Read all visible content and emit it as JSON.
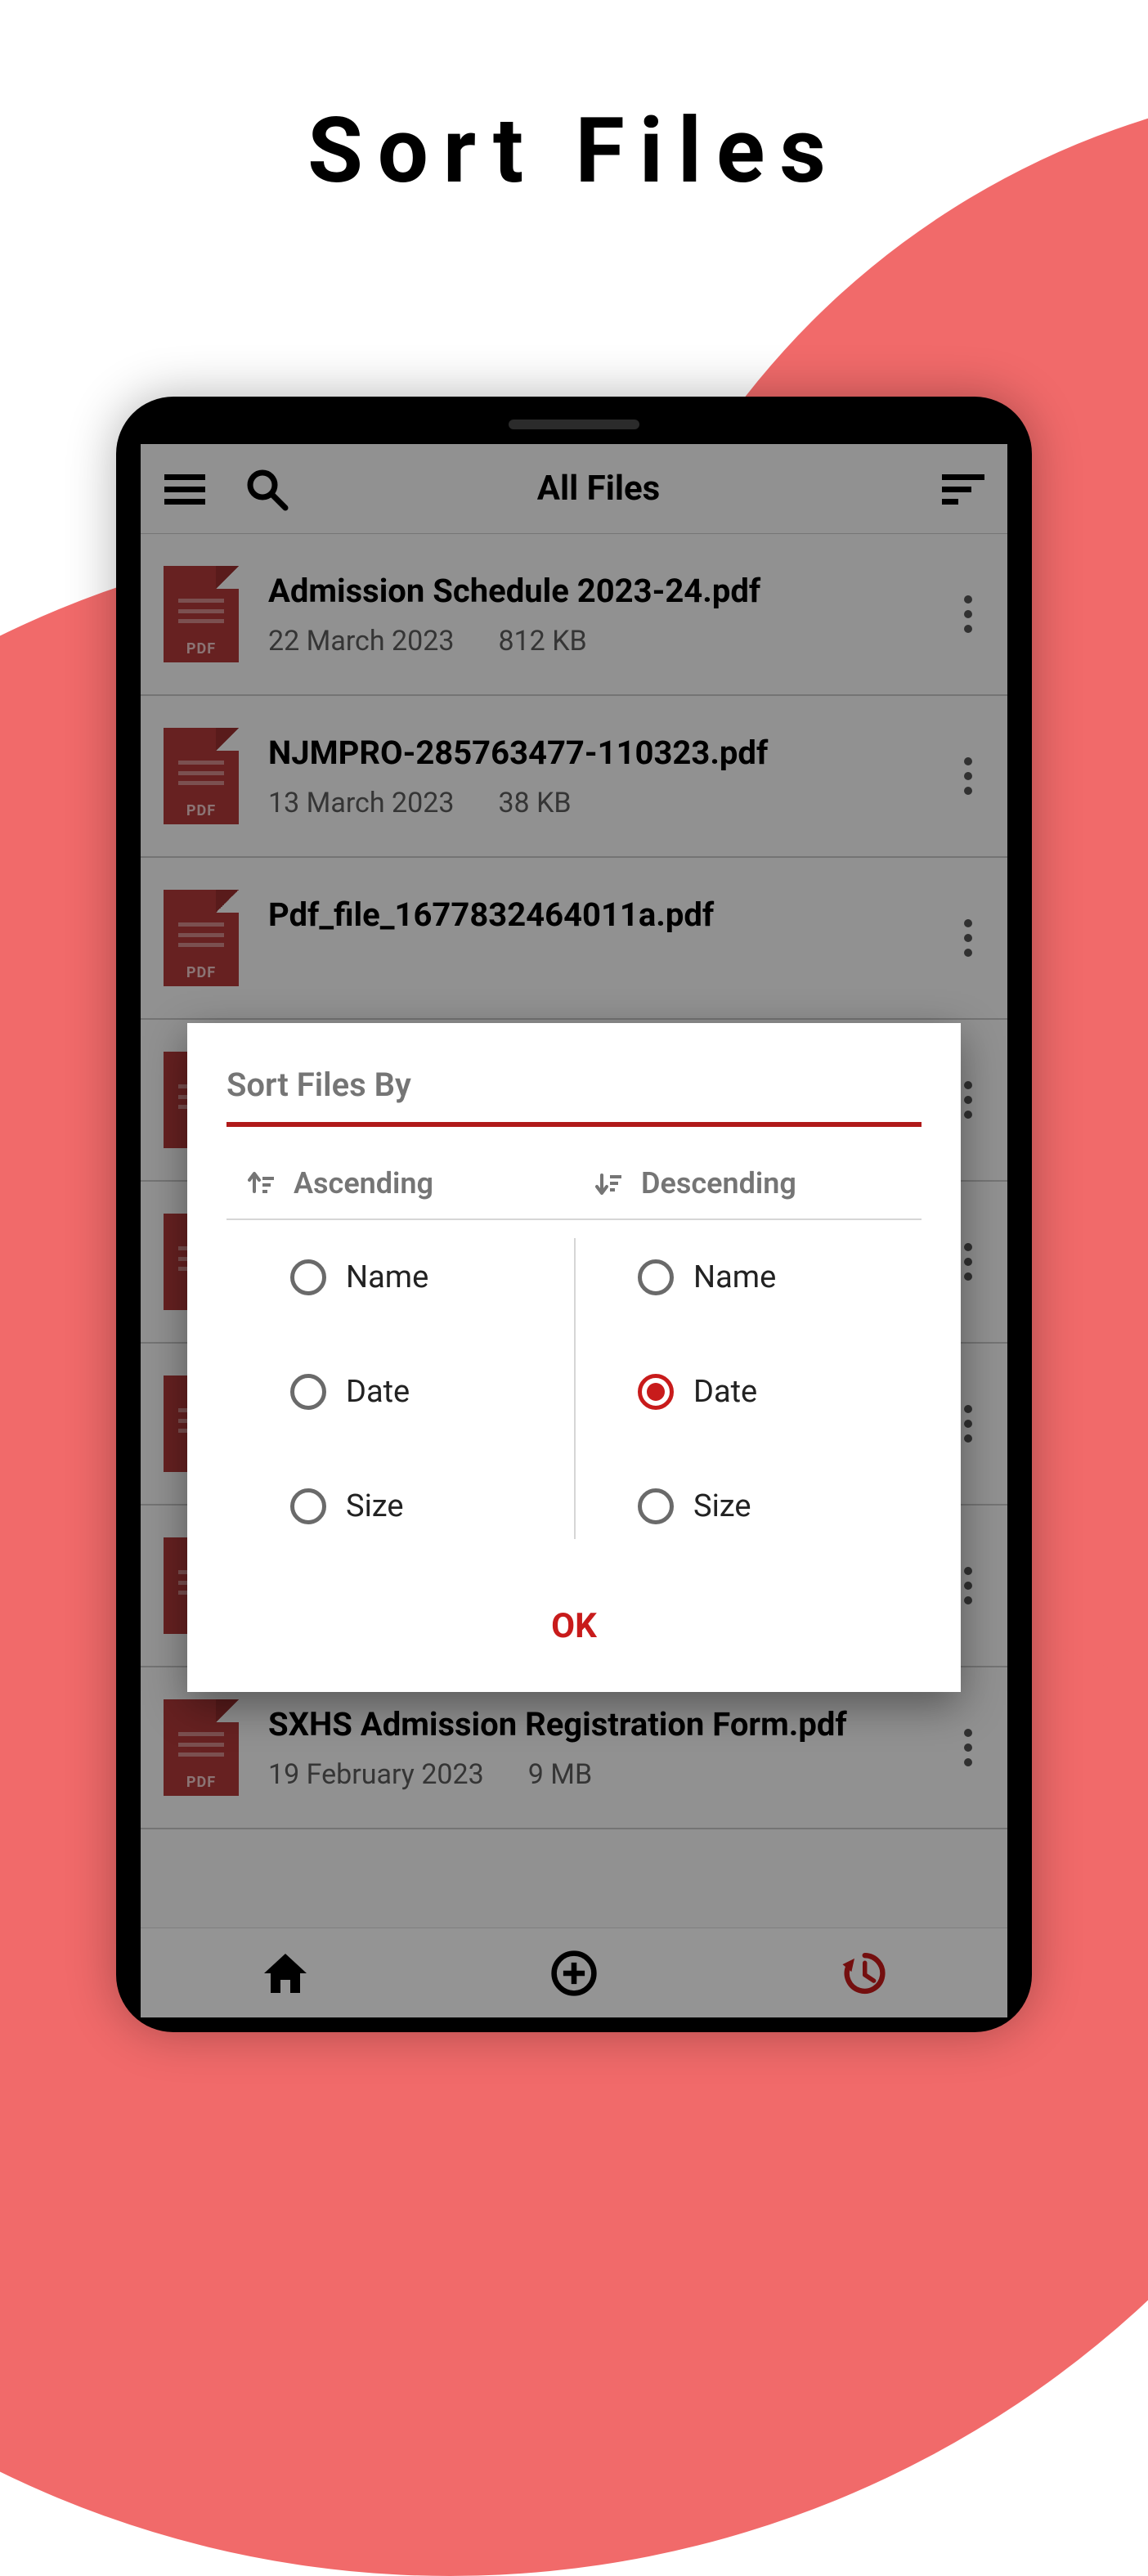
{
  "promo_title": "Sort Files",
  "topbar": {
    "title": "All Files"
  },
  "files": [
    {
      "name": "Admission Schedule 2023-24.pdf",
      "date": "22 March 2023",
      "size": "812 KB"
    },
    {
      "name": "NJMPRO-285763477-110323.pdf",
      "date": "13 March 2023",
      "size": "38 KB"
    },
    {
      "name": "Pdf_file_1677832464011a.pdf",
      "date": "",
      "size": ""
    },
    {
      "name": "",
      "date": "",
      "size": ""
    },
    {
      "name": "",
      "date": "",
      "size": ""
    },
    {
      "name": "",
      "date": "",
      "size": ""
    },
    {
      "name": "",
      "date": "",
      "size": ""
    },
    {
      "name": "SXHS Admission Registration Form.pdf",
      "date": "19 February 2023",
      "size": "9 MB"
    }
  ],
  "dialog": {
    "title": "Sort Files By",
    "ok": "OK",
    "ascending": {
      "label": "Ascending",
      "options": [
        "Name",
        "Date",
        "Size"
      ],
      "selected": null
    },
    "descending": {
      "label": "Descending",
      "options": [
        "Name",
        "Date",
        "Size"
      ],
      "selected": "Date"
    }
  },
  "pdf_tag": "PDF"
}
